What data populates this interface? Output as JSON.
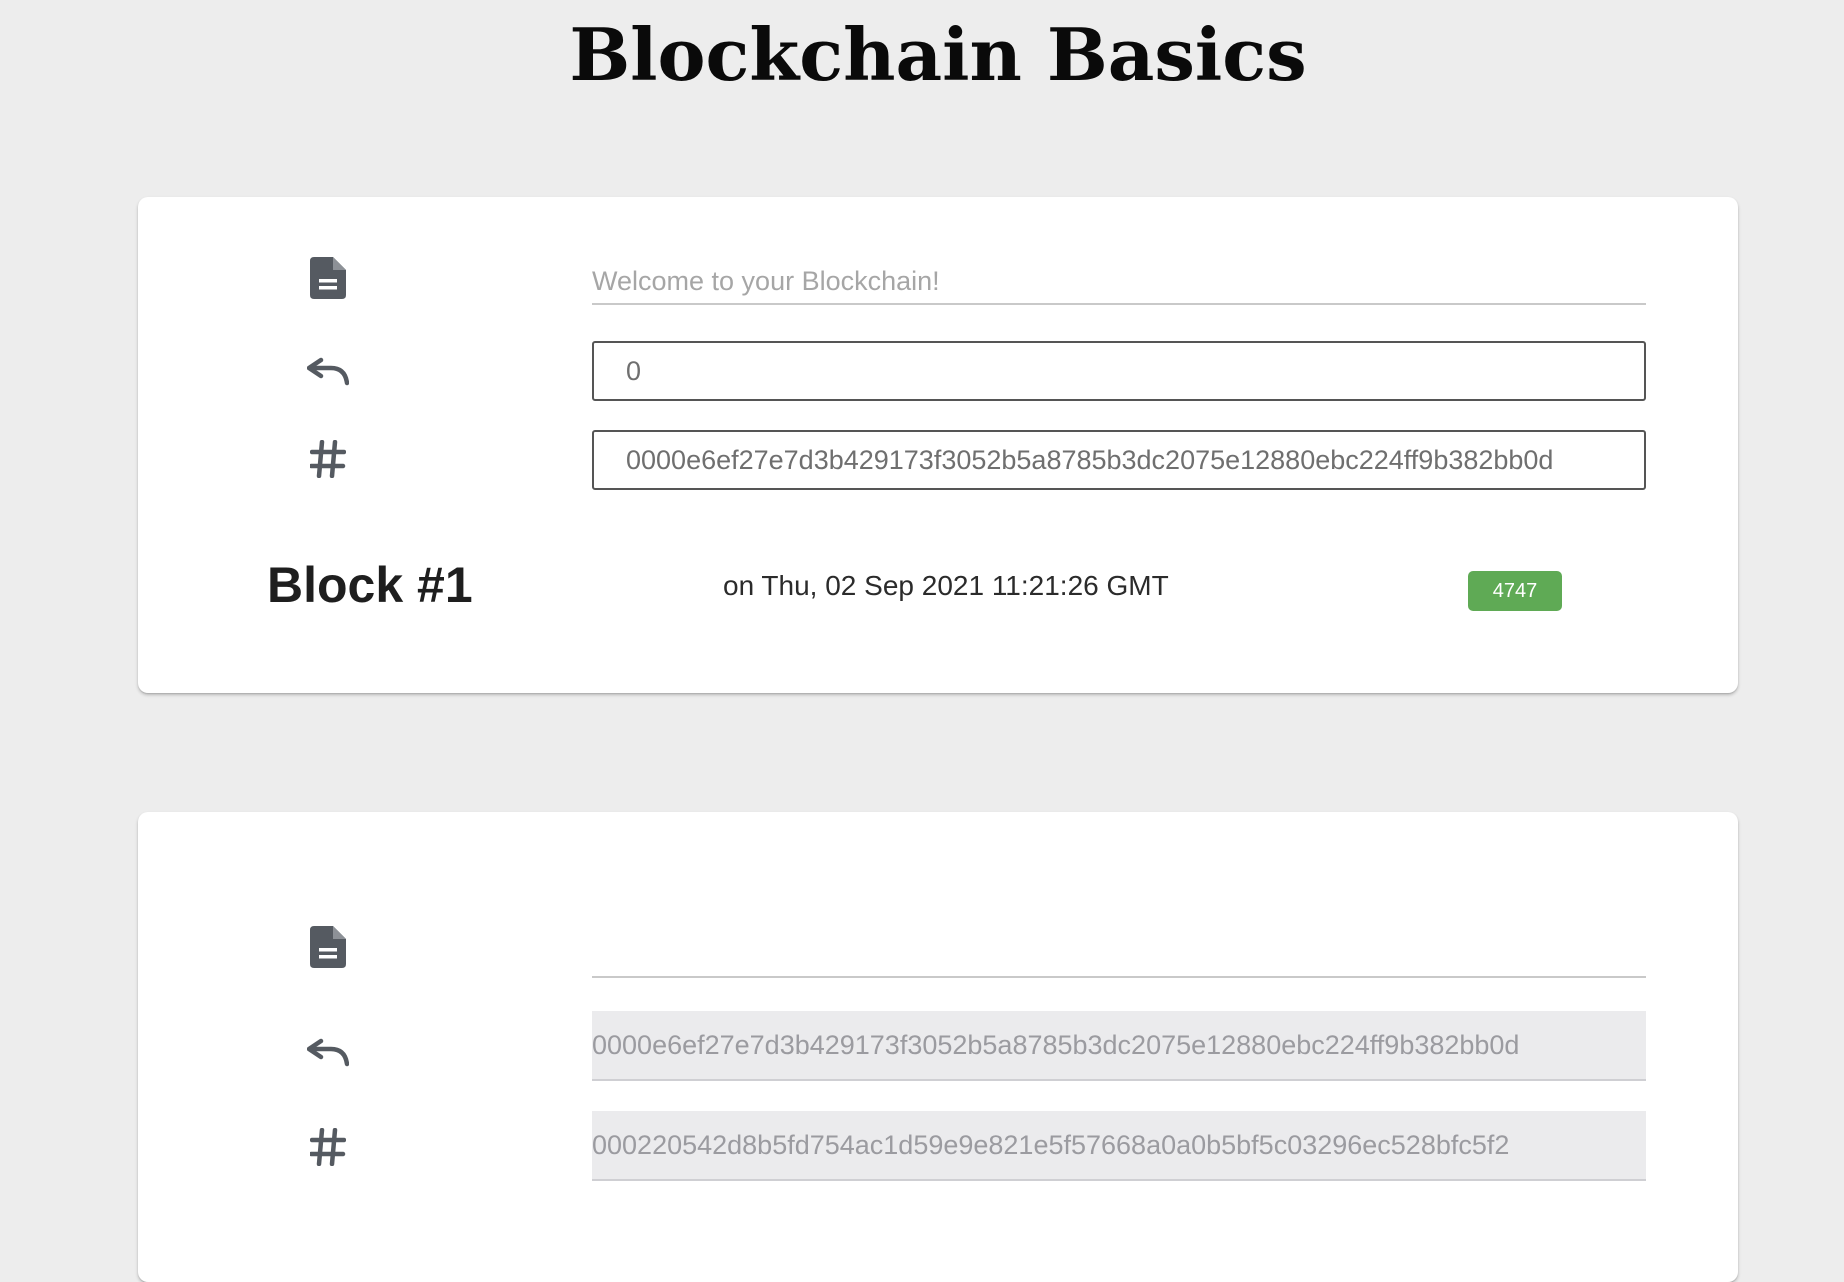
{
  "header": {
    "title": "Blockchain Basics"
  },
  "blocks": [
    {
      "data_placeholder": "Welcome to your Blockchain!",
      "data_value": "",
      "previous_hash": "0",
      "hash": "0000e6ef27e7d3b429173f3052b5a8785b3dc2075e12880ebc224ff9b382bb0d",
      "title": "Block #1",
      "timestamp": "on Thu, 02 Sep 2021 11:21:26 GMT",
      "nonce": "4747"
    },
    {
      "data_placeholder": "",
      "data_value": "",
      "previous_hash": "0000e6ef27e7d3b429173f3052b5a8785b3dc2075e12880ebc224ff9b382bb0d",
      "hash": "000220542d8b5fd754ac1d59e9e821e5f57668a0a0b5bf5c03296ec528bfc5f2"
    }
  ],
  "icons": {
    "data": "document-icon",
    "previous_hash": "undo-arrow-icon",
    "hash": "hashtag-icon"
  },
  "colors": {
    "background": "#ededed",
    "card": "#ffffff",
    "badge": "#5faa55",
    "icon": "#555a61"
  }
}
